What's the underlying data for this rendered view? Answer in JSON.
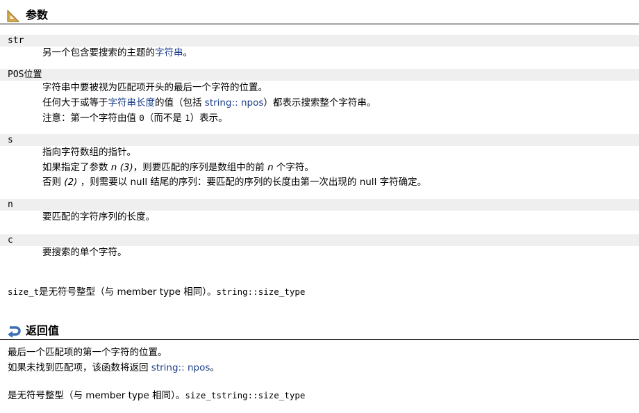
{
  "params_section": {
    "title": "参数"
  },
  "params": [
    {
      "name": "str",
      "lines": [
        [
          {
            "t": "另一个包含要搜索的主题的"
          },
          {
            "t": "字符串",
            "link": true
          },
          {
            "t": "。"
          }
        ]
      ]
    },
    {
      "name": "POS位置",
      "lines": [
        [
          {
            "t": "字符串中要被视为匹配项开头的最后一个字符的位置。"
          }
        ],
        [
          {
            "t": "任何大于或等于"
          },
          {
            "t": "字符串长度",
            "link": true
          },
          {
            "t": "的值（包括 "
          },
          {
            "t": "string:: npos",
            "link": true
          },
          {
            "t": "）都表示搜索整个字符串。"
          }
        ],
        [
          {
            "t": "注意：第一个字符由值 "
          },
          {
            "t": "0",
            "mono": true
          },
          {
            "t": "（而不是 "
          },
          {
            "t": "1",
            "mono": true
          },
          {
            "t": "）表示。"
          }
        ]
      ]
    },
    {
      "name": "s",
      "lines": [
        [
          {
            "t": "指向字符数组的指针。"
          }
        ],
        [
          {
            "t": "如果指定了参数 "
          },
          {
            "t": "n",
            "it": true
          },
          {
            "t": " (3)",
            "it": true
          },
          {
            "t": "，则要匹配的序列是数组中的前 "
          },
          {
            "t": "n",
            "it": true
          },
          {
            "t": " 个字符。"
          }
        ],
        [
          {
            "t": "否则 "
          },
          {
            "t": "(2)",
            "it": true
          },
          {
            "t": " ，则需要以 null 结尾的序列：要匹配的序列的长度由第一次出现的 null 字符确定。"
          }
        ]
      ]
    },
    {
      "name": "n",
      "lines": [
        [
          {
            "t": "要匹配的字符序列的长度。"
          }
        ]
      ]
    },
    {
      "name": "c",
      "lines": [
        [
          {
            "t": "要搜索的单个字符。"
          }
        ]
      ]
    }
  ],
  "size_note": [
    {
      "t": "size_t",
      "mono": true
    },
    {
      "t": "是无符号整型（与 member type 相同）。"
    },
    {
      "t": "string::size_type",
      "mono": true
    }
  ],
  "return_section": {
    "title": "返回值"
  },
  "return_lines": [
    [
      {
        "t": "最后一个匹配项的第一个字符的位置。"
      }
    ],
    [
      {
        "t": "如果未找到匹配项，该函数将返回 "
      },
      {
        "t": "string:: npos",
        "link": true
      },
      {
        "t": "。"
      }
    ]
  ],
  "return_note": [
    {
      "t": "是无符号整型（与 member type 相同）。"
    },
    {
      "t": "size_tstring::size_type",
      "mono": true
    }
  ],
  "colors": {
    "link": "#1a3d8a",
    "param_bg": "#efefef",
    "icon_param": "#c89a3a",
    "icon_return": "#3d6fb5"
  }
}
